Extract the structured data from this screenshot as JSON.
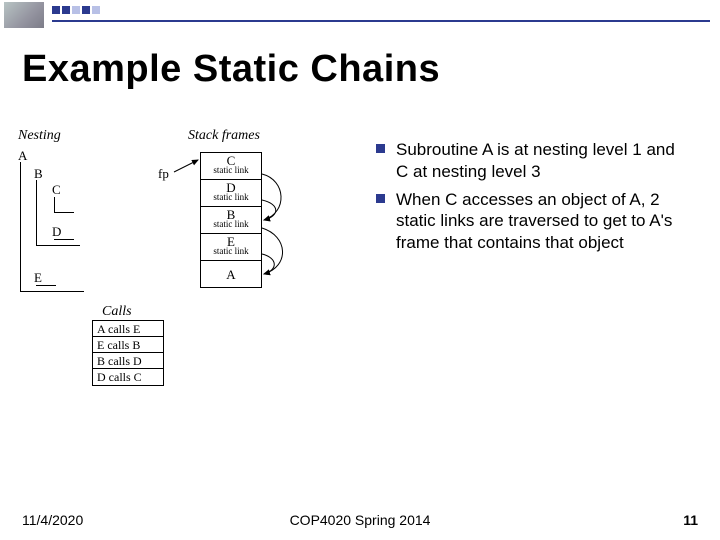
{
  "header": {
    "title": "Example Static Chains"
  },
  "bullets": [
    "Subroutine A is at nesting level 1 and C at nesting level 3",
    "When C accesses an object of A, 2 static links are traversed to get to A's frame that contains that object"
  ],
  "diagram": {
    "nesting_label": "Nesting",
    "stack_label": "Stack frames",
    "calls_label": "Calls",
    "fp_label": "fp",
    "nest_levels": {
      "A": "A",
      "B": "B",
      "C": "C",
      "D": "D",
      "E": "E"
    },
    "calls": [
      "A  calls E",
      "E  calls B",
      "B  calls D",
      "D  calls C"
    ],
    "stack_frames": [
      {
        "name": "C",
        "sub": "static link"
      },
      {
        "name": "D",
        "sub": "static link"
      },
      {
        "name": "B",
        "sub": "static link"
      },
      {
        "name": "E",
        "sub": "static link"
      },
      {
        "name": "A",
        "sub": ""
      }
    ]
  },
  "footer": {
    "date": "11/4/2020",
    "course": "COP4020 Spring 2014",
    "page": "11"
  }
}
